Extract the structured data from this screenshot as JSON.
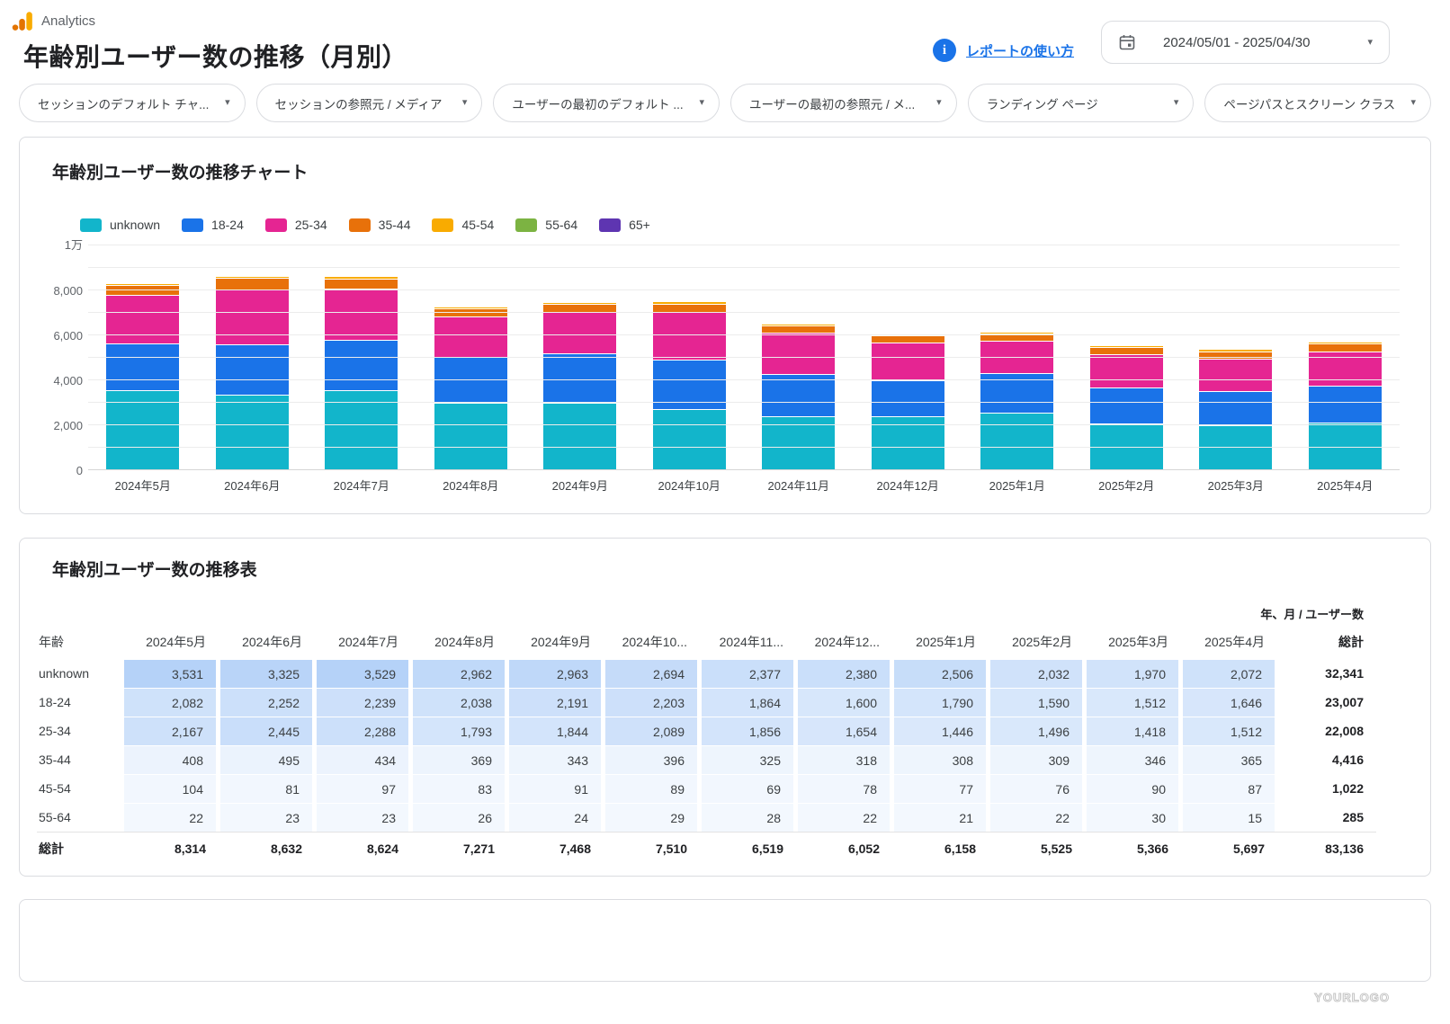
{
  "header": {
    "brand": "Analytics",
    "title": "年齢別ユーザー数の推移（月別）",
    "help_link": "レポートの使い方",
    "date_range": "2024/05/01 - 2025/04/30"
  },
  "filters": [
    "セッションのデフォルト チャ...",
    "セッションの参照元 / メディア",
    "ユーザーの最初のデフォルト ...",
    "ユーザーの最初の参照元 / メ...",
    "ランディング ページ",
    "ページパスとスクリーン クラス"
  ],
  "chart": {
    "title": "年齢別ユーザー数の推移チャート"
  },
  "chart_data": {
    "type": "bar",
    "stacked": true,
    "title": "年齢別ユーザー数の推移チャート",
    "categories": [
      "2024年5月",
      "2024年6月",
      "2024年7月",
      "2024年8月",
      "2024年9月",
      "2024年10月",
      "2024年11月",
      "2024年12月",
      "2025年1月",
      "2025年2月",
      "2025年3月",
      "2025年4月"
    ],
    "series": [
      {
        "name": "unknown",
        "color": "#12B5CB",
        "values": [
          3531,
          3325,
          3529,
          2962,
          2963,
          2694,
          2377,
          2380,
          2506,
          2032,
          1970,
          2072
        ]
      },
      {
        "name": "18-24",
        "color": "#1A73E8",
        "values": [
          2082,
          2252,
          2239,
          2038,
          2191,
          2203,
          1864,
          1600,
          1790,
          1590,
          1512,
          1646
        ]
      },
      {
        "name": "25-34",
        "color": "#E52592",
        "values": [
          2167,
          2445,
          2288,
          1793,
          1844,
          2089,
          1856,
          1654,
          1446,
          1496,
          1418,
          1512
        ]
      },
      {
        "name": "35-44",
        "color": "#E8710A",
        "values": [
          408,
          495,
          434,
          369,
          343,
          396,
          325,
          318,
          308,
          309,
          346,
          365
        ]
      },
      {
        "name": "45-54",
        "color": "#F9AB00",
        "values": [
          104,
          81,
          97,
          83,
          91,
          89,
          69,
          78,
          77,
          76,
          90,
          87
        ]
      },
      {
        "name": "55-64",
        "color": "#7CB342",
        "values": [
          22,
          23,
          23,
          26,
          24,
          29,
          28,
          22,
          21,
          22,
          30,
          15
        ]
      }
    ],
    "legend": [
      {
        "name": "unknown",
        "color": "#12B5CB"
      },
      {
        "name": "18-24",
        "color": "#1A73E8"
      },
      {
        "name": "25-34",
        "color": "#E52592"
      },
      {
        "name": "35-44",
        "color": "#E8710A"
      },
      {
        "name": "45-54",
        "color": "#F9AB00"
      },
      {
        "name": "55-64",
        "color": "#7CB342"
      },
      {
        "name": "65+",
        "color": "#5E35B1"
      }
    ],
    "ylim": [
      0,
      10000
    ],
    "yticks": [
      {
        "value": 0,
        "label": "0"
      },
      {
        "value": 2000,
        "label": "2,000"
      },
      {
        "value": 4000,
        "label": "4,000"
      },
      {
        "value": 6000,
        "label": "6,000"
      },
      {
        "value": 8000,
        "label": "8,000"
      },
      {
        "value": 10000,
        "label": "1万"
      }
    ],
    "minor_grid_step": 1000,
    "grid": true,
    "legend_position": "top",
    "xlabel": "",
    "ylabel": ""
  },
  "table": {
    "title": "年齢別ユーザー数の推移表",
    "metric_label": "年、月 / ユーザー数",
    "dimension_header": "年齢",
    "total_label": "総計",
    "columns": [
      "2024年5月",
      "2024年6月",
      "2024年7月",
      "2024年8月",
      "2024年9月",
      "2024年10...",
      "2024年11...",
      "2024年12...",
      "2025年1月",
      "2025年2月",
      "2025年3月",
      "2025年4月"
    ],
    "rows": [
      {
        "label": "unknown",
        "values": [
          3531,
          3325,
          3529,
          2962,
          2963,
          2694,
          2377,
          2380,
          2506,
          2032,
          1970,
          2072
        ],
        "total": 32341
      },
      {
        "label": "18-24",
        "values": [
          2082,
          2252,
          2239,
          2038,
          2191,
          2203,
          1864,
          1600,
          1790,
          1590,
          1512,
          1646
        ],
        "total": 23007
      },
      {
        "label": "25-34",
        "values": [
          2167,
          2445,
          2288,
          1793,
          1844,
          2089,
          1856,
          1654,
          1446,
          1496,
          1418,
          1512
        ],
        "total": 22008
      },
      {
        "label": "35-44",
        "values": [
          408,
          495,
          434,
          369,
          343,
          396,
          325,
          318,
          308,
          309,
          346,
          365
        ],
        "total": 4416
      },
      {
        "label": "45-54",
        "values": [
          104,
          81,
          97,
          83,
          91,
          89,
          69,
          78,
          77,
          76,
          90,
          87
        ],
        "total": 1022
      },
      {
        "label": "55-64",
        "values": [
          22,
          23,
          23,
          26,
          24,
          29,
          28,
          22,
          21,
          22,
          30,
          15
        ],
        "total": 285
      }
    ],
    "grand_total_row": {
      "label": "総計",
      "values": [
        8314,
        8632,
        8624,
        7271,
        7468,
        7510,
        6519,
        6052,
        6158,
        5525,
        5366,
        5697
      ],
      "total": 83136
    },
    "heatmap_color": "#1A73E8"
  },
  "watermark": "YOURLOGO",
  "colors": {
    "accent": "#1A73E8",
    "border": "#DADCE0",
    "text_primary": "#202124",
    "text_secondary": "#5F6368"
  }
}
